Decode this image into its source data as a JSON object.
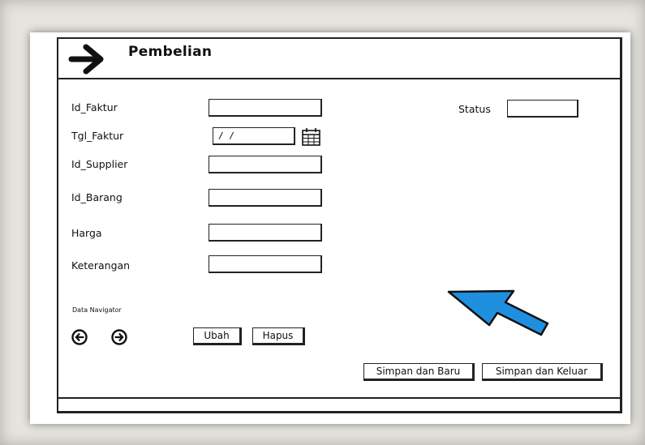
{
  "window": {
    "title": "Pembelian"
  },
  "form": {
    "fields": [
      {
        "label": "Id_Faktur",
        "value": ""
      },
      {
        "label": "Tgl_Faktur",
        "value": "/ /"
      },
      {
        "label": "Id_Supplier",
        "value": ""
      },
      {
        "label": "Id_Barang",
        "value": ""
      },
      {
        "label": "Harga",
        "value": ""
      },
      {
        "label": "Keterangan",
        "value": ""
      }
    ],
    "status": {
      "label": "Status",
      "value": ""
    }
  },
  "navigator": {
    "label": "Data Navigator"
  },
  "buttons": {
    "ubah": "Ubah",
    "hapus": "Hapus",
    "simpan_baru": "Simpan dan Baru",
    "simpan_keluar": "Simpan dan Keluar"
  },
  "colors": {
    "pointer_arrow": "#1f8fe0"
  },
  "icons": [
    "arrow-right-icon",
    "calendar-icon",
    "prev-circle-icon",
    "next-circle-icon",
    "pointer-arrow-icon"
  ]
}
